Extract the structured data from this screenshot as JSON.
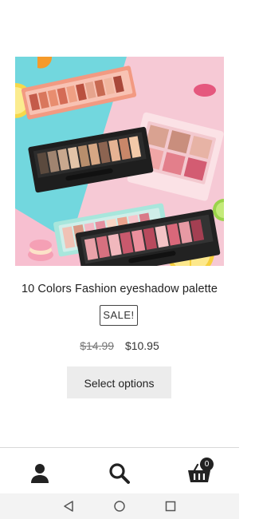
{
  "product": {
    "title": "10 Colors Fashion eyeshadow palette",
    "badge": "SALE!",
    "price_old": "$14.99",
    "price_new": "$10.95",
    "button_label": "Select options",
    "image_icon": "eyeshadow-palette-product-photo"
  },
  "bottom_nav": {
    "items": [
      {
        "icon": "account-icon"
      },
      {
        "icon": "search-icon"
      },
      {
        "icon": "cart-icon"
      }
    ],
    "cart_count": "0"
  },
  "system_nav": {
    "items": [
      {
        "icon": "back-icon"
      },
      {
        "icon": "home-icon"
      },
      {
        "icon": "recents-icon"
      }
    ]
  },
  "colors": {
    "accent_dark": "#222222",
    "button_bg": "#ececec",
    "image_bg_left": "#6fd6dc",
    "image_bg_right": "#f5c6d3"
  }
}
